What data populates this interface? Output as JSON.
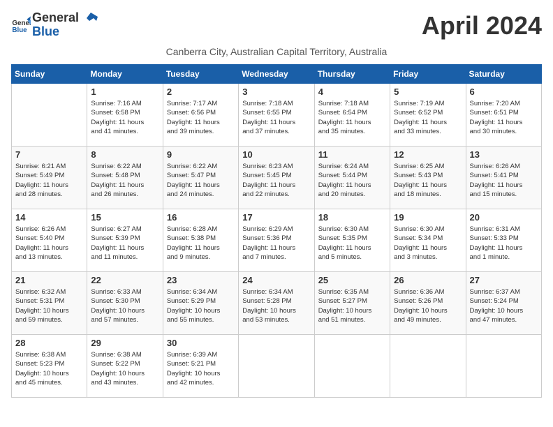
{
  "logo": {
    "text_general": "General",
    "text_blue": "Blue"
  },
  "title": "April 2024",
  "subtitle": "Canberra City, Australian Capital Territory, Australia",
  "days_of_week": [
    "Sunday",
    "Monday",
    "Tuesday",
    "Wednesday",
    "Thursday",
    "Friday",
    "Saturday"
  ],
  "weeks": [
    [
      {
        "day": "",
        "info": ""
      },
      {
        "day": "1",
        "info": "Sunrise: 7:16 AM\nSunset: 6:58 PM\nDaylight: 11 hours\nand 41 minutes."
      },
      {
        "day": "2",
        "info": "Sunrise: 7:17 AM\nSunset: 6:56 PM\nDaylight: 11 hours\nand 39 minutes."
      },
      {
        "day": "3",
        "info": "Sunrise: 7:18 AM\nSunset: 6:55 PM\nDaylight: 11 hours\nand 37 minutes."
      },
      {
        "day": "4",
        "info": "Sunrise: 7:18 AM\nSunset: 6:54 PM\nDaylight: 11 hours\nand 35 minutes."
      },
      {
        "day": "5",
        "info": "Sunrise: 7:19 AM\nSunset: 6:52 PM\nDaylight: 11 hours\nand 33 minutes."
      },
      {
        "day": "6",
        "info": "Sunrise: 7:20 AM\nSunset: 6:51 PM\nDaylight: 11 hours\nand 30 minutes."
      }
    ],
    [
      {
        "day": "7",
        "info": "Sunrise: 6:21 AM\nSunset: 5:49 PM\nDaylight: 11 hours\nand 28 minutes."
      },
      {
        "day": "8",
        "info": "Sunrise: 6:22 AM\nSunset: 5:48 PM\nDaylight: 11 hours\nand 26 minutes."
      },
      {
        "day": "9",
        "info": "Sunrise: 6:22 AM\nSunset: 5:47 PM\nDaylight: 11 hours\nand 24 minutes."
      },
      {
        "day": "10",
        "info": "Sunrise: 6:23 AM\nSunset: 5:45 PM\nDaylight: 11 hours\nand 22 minutes."
      },
      {
        "day": "11",
        "info": "Sunrise: 6:24 AM\nSunset: 5:44 PM\nDaylight: 11 hours\nand 20 minutes."
      },
      {
        "day": "12",
        "info": "Sunrise: 6:25 AM\nSunset: 5:43 PM\nDaylight: 11 hours\nand 18 minutes."
      },
      {
        "day": "13",
        "info": "Sunrise: 6:26 AM\nSunset: 5:41 PM\nDaylight: 11 hours\nand 15 minutes."
      }
    ],
    [
      {
        "day": "14",
        "info": "Sunrise: 6:26 AM\nSunset: 5:40 PM\nDaylight: 11 hours\nand 13 minutes."
      },
      {
        "day": "15",
        "info": "Sunrise: 6:27 AM\nSunset: 5:39 PM\nDaylight: 11 hours\nand 11 minutes."
      },
      {
        "day": "16",
        "info": "Sunrise: 6:28 AM\nSunset: 5:38 PM\nDaylight: 11 hours\nand 9 minutes."
      },
      {
        "day": "17",
        "info": "Sunrise: 6:29 AM\nSunset: 5:36 PM\nDaylight: 11 hours\nand 7 minutes."
      },
      {
        "day": "18",
        "info": "Sunrise: 6:30 AM\nSunset: 5:35 PM\nDaylight: 11 hours\nand 5 minutes."
      },
      {
        "day": "19",
        "info": "Sunrise: 6:30 AM\nSunset: 5:34 PM\nDaylight: 11 hours\nand 3 minutes."
      },
      {
        "day": "20",
        "info": "Sunrise: 6:31 AM\nSunset: 5:33 PM\nDaylight: 11 hours\nand 1 minute."
      }
    ],
    [
      {
        "day": "21",
        "info": "Sunrise: 6:32 AM\nSunset: 5:31 PM\nDaylight: 10 hours\nand 59 minutes."
      },
      {
        "day": "22",
        "info": "Sunrise: 6:33 AM\nSunset: 5:30 PM\nDaylight: 10 hours\nand 57 minutes."
      },
      {
        "day": "23",
        "info": "Sunrise: 6:34 AM\nSunset: 5:29 PM\nDaylight: 10 hours\nand 55 minutes."
      },
      {
        "day": "24",
        "info": "Sunrise: 6:34 AM\nSunset: 5:28 PM\nDaylight: 10 hours\nand 53 minutes."
      },
      {
        "day": "25",
        "info": "Sunrise: 6:35 AM\nSunset: 5:27 PM\nDaylight: 10 hours\nand 51 minutes."
      },
      {
        "day": "26",
        "info": "Sunrise: 6:36 AM\nSunset: 5:26 PM\nDaylight: 10 hours\nand 49 minutes."
      },
      {
        "day": "27",
        "info": "Sunrise: 6:37 AM\nSunset: 5:24 PM\nDaylight: 10 hours\nand 47 minutes."
      }
    ],
    [
      {
        "day": "28",
        "info": "Sunrise: 6:38 AM\nSunset: 5:23 PM\nDaylight: 10 hours\nand 45 minutes."
      },
      {
        "day": "29",
        "info": "Sunrise: 6:38 AM\nSunset: 5:22 PM\nDaylight: 10 hours\nand 43 minutes."
      },
      {
        "day": "30",
        "info": "Sunrise: 6:39 AM\nSunset: 5:21 PM\nDaylight: 10 hours\nand 42 minutes."
      },
      {
        "day": "",
        "info": ""
      },
      {
        "day": "",
        "info": ""
      },
      {
        "day": "",
        "info": ""
      },
      {
        "day": "",
        "info": ""
      }
    ]
  ]
}
